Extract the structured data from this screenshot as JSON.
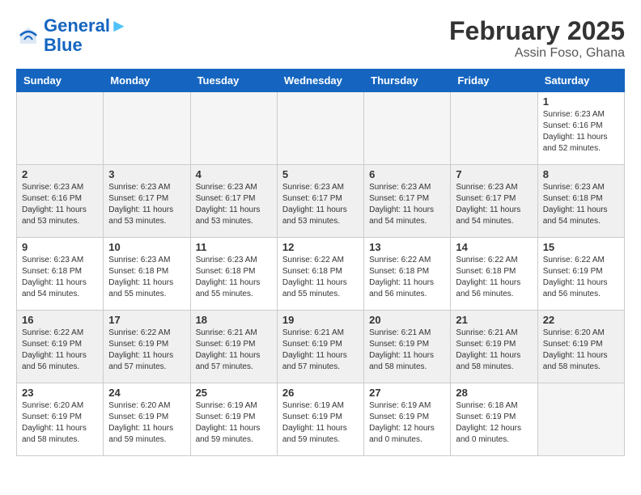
{
  "header": {
    "logo_line1": "General",
    "logo_line2": "Blue",
    "month_year": "February 2025",
    "location": "Assin Foso, Ghana"
  },
  "weekdays": [
    "Sunday",
    "Monday",
    "Tuesday",
    "Wednesday",
    "Thursday",
    "Friday",
    "Saturday"
  ],
  "weeks": [
    [
      {
        "day": "",
        "info": ""
      },
      {
        "day": "",
        "info": ""
      },
      {
        "day": "",
        "info": ""
      },
      {
        "day": "",
        "info": ""
      },
      {
        "day": "",
        "info": ""
      },
      {
        "day": "",
        "info": ""
      },
      {
        "day": "1",
        "info": "Sunrise: 6:23 AM\nSunset: 6:16 PM\nDaylight: 11 hours\nand 52 minutes."
      }
    ],
    [
      {
        "day": "2",
        "info": "Sunrise: 6:23 AM\nSunset: 6:16 PM\nDaylight: 11 hours\nand 53 minutes."
      },
      {
        "day": "3",
        "info": "Sunrise: 6:23 AM\nSunset: 6:17 PM\nDaylight: 11 hours\nand 53 minutes."
      },
      {
        "day": "4",
        "info": "Sunrise: 6:23 AM\nSunset: 6:17 PM\nDaylight: 11 hours\nand 53 minutes."
      },
      {
        "day": "5",
        "info": "Sunrise: 6:23 AM\nSunset: 6:17 PM\nDaylight: 11 hours\nand 53 minutes."
      },
      {
        "day": "6",
        "info": "Sunrise: 6:23 AM\nSunset: 6:17 PM\nDaylight: 11 hours\nand 54 minutes."
      },
      {
        "day": "7",
        "info": "Sunrise: 6:23 AM\nSunset: 6:17 PM\nDaylight: 11 hours\nand 54 minutes."
      },
      {
        "day": "8",
        "info": "Sunrise: 6:23 AM\nSunset: 6:18 PM\nDaylight: 11 hours\nand 54 minutes."
      }
    ],
    [
      {
        "day": "9",
        "info": "Sunrise: 6:23 AM\nSunset: 6:18 PM\nDaylight: 11 hours\nand 54 minutes."
      },
      {
        "day": "10",
        "info": "Sunrise: 6:23 AM\nSunset: 6:18 PM\nDaylight: 11 hours\nand 55 minutes."
      },
      {
        "day": "11",
        "info": "Sunrise: 6:23 AM\nSunset: 6:18 PM\nDaylight: 11 hours\nand 55 minutes."
      },
      {
        "day": "12",
        "info": "Sunrise: 6:22 AM\nSunset: 6:18 PM\nDaylight: 11 hours\nand 55 minutes."
      },
      {
        "day": "13",
        "info": "Sunrise: 6:22 AM\nSunset: 6:18 PM\nDaylight: 11 hours\nand 56 minutes."
      },
      {
        "day": "14",
        "info": "Sunrise: 6:22 AM\nSunset: 6:18 PM\nDaylight: 11 hours\nand 56 minutes."
      },
      {
        "day": "15",
        "info": "Sunrise: 6:22 AM\nSunset: 6:19 PM\nDaylight: 11 hours\nand 56 minutes."
      }
    ],
    [
      {
        "day": "16",
        "info": "Sunrise: 6:22 AM\nSunset: 6:19 PM\nDaylight: 11 hours\nand 56 minutes."
      },
      {
        "day": "17",
        "info": "Sunrise: 6:22 AM\nSunset: 6:19 PM\nDaylight: 11 hours\nand 57 minutes."
      },
      {
        "day": "18",
        "info": "Sunrise: 6:21 AM\nSunset: 6:19 PM\nDaylight: 11 hours\nand 57 minutes."
      },
      {
        "day": "19",
        "info": "Sunrise: 6:21 AM\nSunset: 6:19 PM\nDaylight: 11 hours\nand 57 minutes."
      },
      {
        "day": "20",
        "info": "Sunrise: 6:21 AM\nSunset: 6:19 PM\nDaylight: 11 hours\nand 58 minutes."
      },
      {
        "day": "21",
        "info": "Sunrise: 6:21 AM\nSunset: 6:19 PM\nDaylight: 11 hours\nand 58 minutes."
      },
      {
        "day": "22",
        "info": "Sunrise: 6:20 AM\nSunset: 6:19 PM\nDaylight: 11 hours\nand 58 minutes."
      }
    ],
    [
      {
        "day": "23",
        "info": "Sunrise: 6:20 AM\nSunset: 6:19 PM\nDaylight: 11 hours\nand 58 minutes."
      },
      {
        "day": "24",
        "info": "Sunrise: 6:20 AM\nSunset: 6:19 PM\nDaylight: 11 hours\nand 59 minutes."
      },
      {
        "day": "25",
        "info": "Sunrise: 6:19 AM\nSunset: 6:19 PM\nDaylight: 11 hours\nand 59 minutes."
      },
      {
        "day": "26",
        "info": "Sunrise: 6:19 AM\nSunset: 6:19 PM\nDaylight: 11 hours\nand 59 minutes."
      },
      {
        "day": "27",
        "info": "Sunrise: 6:19 AM\nSunset: 6:19 PM\nDaylight: 12 hours\nand 0 minutes."
      },
      {
        "day": "28",
        "info": "Sunrise: 6:18 AM\nSunset: 6:19 PM\nDaylight: 12 hours\nand 0 minutes."
      },
      {
        "day": "",
        "info": ""
      }
    ]
  ]
}
